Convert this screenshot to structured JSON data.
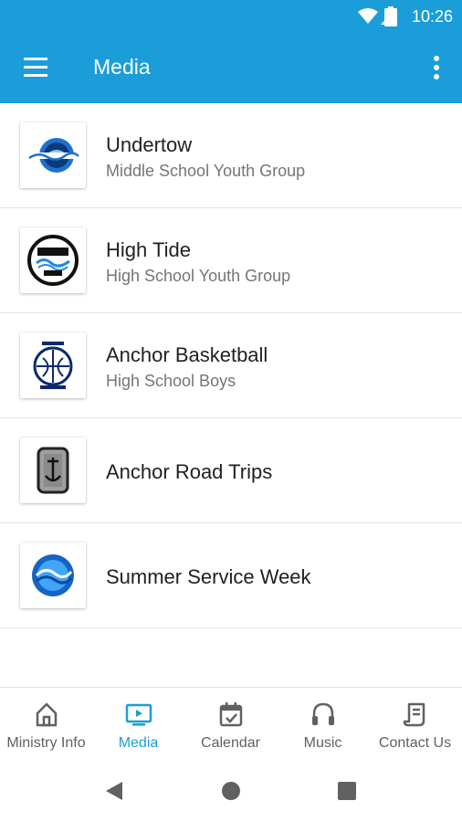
{
  "status_bar": {
    "time": "10:26"
  },
  "app_bar": {
    "title": "Media"
  },
  "media_items": [
    {
      "title": "Undertow",
      "subtitle": "Middle School Youth Group"
    },
    {
      "title": "High Tide",
      "subtitle": "High School Youth Group"
    },
    {
      "title": "Anchor Basketball",
      "subtitle": "High School Boys"
    },
    {
      "title": "Anchor Road Trips",
      "subtitle": ""
    },
    {
      "title": "Summer Service Week",
      "subtitle": ""
    }
  ],
  "bottom_nav": [
    {
      "label": "Ministry Info",
      "icon": "home-icon"
    },
    {
      "label": "Media",
      "icon": "media-icon",
      "active": true
    },
    {
      "label": "Calendar",
      "icon": "calendar-icon"
    },
    {
      "label": "Music",
      "icon": "headphones-icon"
    },
    {
      "label": "Contact Us",
      "icon": "contact-icon"
    }
  ],
  "colors": {
    "primary": "#1a9dd9",
    "text": "#212121",
    "secondary_text": "#757575"
  }
}
